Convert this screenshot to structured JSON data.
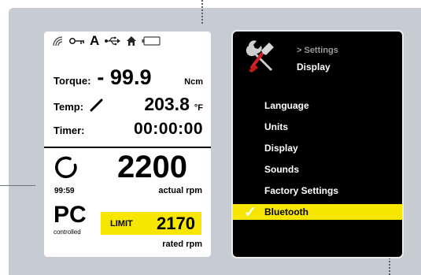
{
  "status_icons": [
    "wireless-icon",
    "key-icon",
    "auto-a-icon",
    "usb-icon",
    "home-icon",
    "battery-icon"
  ],
  "status_letter": "A",
  "torque": {
    "label": "Torque:",
    "value": "- 99.9",
    "unit": "Ncm"
  },
  "temp": {
    "label": "Temp:",
    "value": "203.8",
    "unit": "°F"
  },
  "timer": {
    "label": "Timer:",
    "value": "00:00:00"
  },
  "speed": {
    "value": "2200",
    "time": "99:59",
    "label": "actual rpm"
  },
  "control": {
    "mode": "PC",
    "sub": "controlled"
  },
  "limit": {
    "label": "LIMIT",
    "value": "2170",
    "rated_label": "rated rpm"
  },
  "settings": {
    "breadcrumb": "> Settings",
    "current": "Display"
  },
  "menu": [
    {
      "label": "Language",
      "selected": false
    },
    {
      "label": "Units",
      "selected": false
    },
    {
      "label": "Display",
      "selected": false
    },
    {
      "label": "Sounds",
      "selected": false
    },
    {
      "label": "Factory  Settings",
      "selected": false
    },
    {
      "label": "Bluetooth",
      "selected": true
    }
  ],
  "colors": {
    "background_panel": "#c6ccd2",
    "highlight": "#f7e600",
    "screen_dark": "#000000"
  }
}
